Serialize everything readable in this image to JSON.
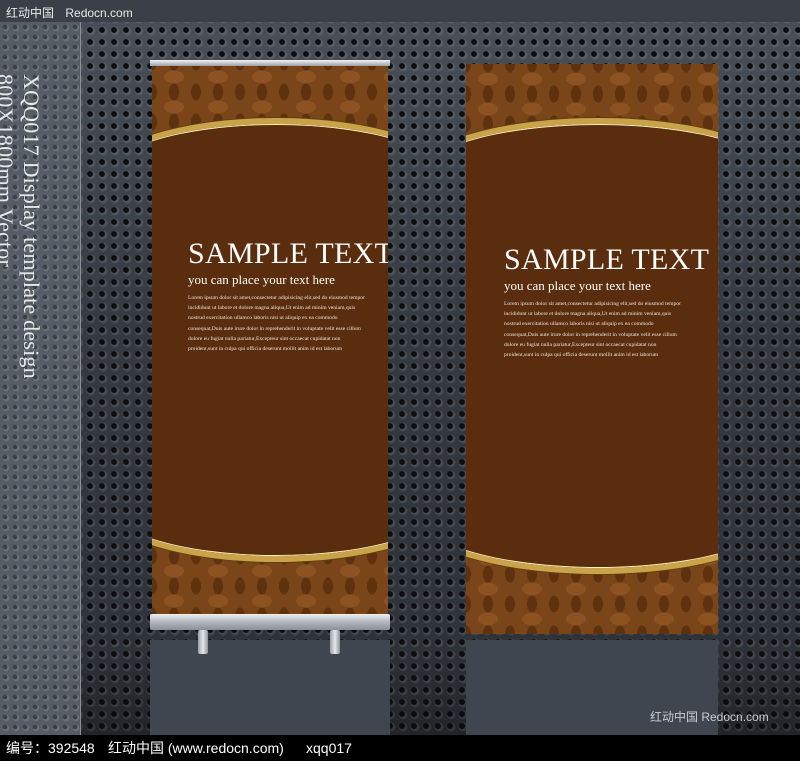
{
  "top_bar": {
    "site_cn": "红动中国",
    "site_en": "Redocn.com"
  },
  "side_title": {
    "line1": "XQQ017 Display template design",
    "line2": "800X1800mm Vector"
  },
  "banners": [
    {
      "title": "SAMPLE TEXT",
      "subtitle": "you can place your text here",
      "body": [
        "Lorem ipsum dolor sit amet,consectetur adipisicing elit,sed do eiusmod tempor",
        "incididunt ut labore et dolore magna aliqua,Ut enim ad minim veniam,quis",
        "nostrud exercitation ullamco laboris nisi ut aliquip ex ea commodo",
        "consequat,Duis aute irure dolor in reprehenderit in voluptate velit esse cillum",
        "dolore eu fugiat nulla pariatur,Excepteur sint occaecat cupidatat non",
        "proident,sunt in culpa qui officia deserunt mollit anim id est laborum"
      ]
    },
    {
      "title": "SAMPLE TEXT",
      "subtitle": "you can place your text here",
      "body": [
        "Lorem ipsum dolor sit amet,consectetur adipisicing elit,sed do eiusmod tempor",
        "incididunt ut labore et dolore magna aliqua,Ut enim ad minim veniam,quis",
        "nostrud exercitation ullamco laboris nisi ut aliquip ex ea commodo",
        "consequat,Duis aute irure dolor in reprehenderit in voluptate velit esse cillum",
        "dolore eu fugiat nulla pariatur,Excepteur sint occaecat cupidatat non",
        "proident,sunt in culpa qui officia deserunt mollit anim id est laborum"
      ]
    }
  ],
  "watermark": "红动中国 Redocn.com",
  "bottom_bar": {
    "id_label": "编号：392548",
    "site": "红动中国 (www.redocn.com)",
    "code": "xqq017"
  },
  "colors": {
    "banner_brown": "#5a2d0e",
    "pattern_brown": "#7a4518",
    "gold": "#c9a24a"
  }
}
